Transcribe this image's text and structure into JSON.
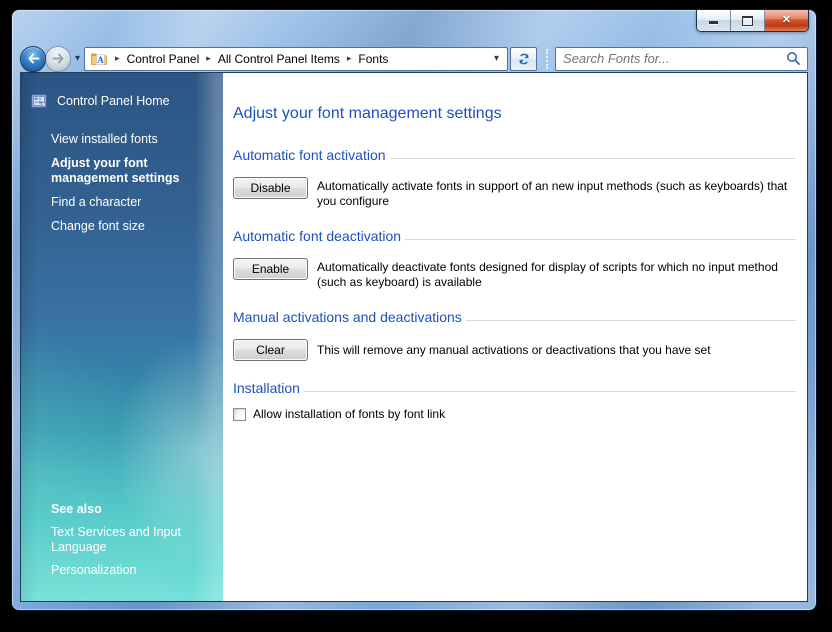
{
  "glyphs": {
    "close": "✕",
    "breadcrumb_separator": "▸",
    "dropdown_arrow": "▾",
    "recent_pages_chevron": "▾"
  },
  "navigation": {
    "breadcrumb": [
      "Control Panel",
      "All Control Panel Items",
      "Fonts"
    ],
    "search_placeholder": "Search Fonts for..."
  },
  "sidebar": {
    "home": "Control Panel Home",
    "links": [
      "View installed fonts",
      "Adjust your font management settings",
      "Find a character",
      "Change font size"
    ],
    "active_link": "Adjust your font management settings",
    "see_also": {
      "title": "See also",
      "links": [
        "Text Services and Input Language",
        "Personalization"
      ]
    }
  },
  "main": {
    "title": "Adjust your font management settings",
    "sections": [
      {
        "heading": "Automatic font activation",
        "button_label": "Disable",
        "description": "Automatically activate fonts in support of an new input methods (such as keyboards) that you configure"
      },
      {
        "heading": "Automatic font deactivation",
        "button_label": "Enable",
        "description": "Automatically deactivate fonts designed for display of scripts for which no input method (such as keyboard) is available"
      },
      {
        "heading": "Manual activations and deactivations",
        "button_label": "Clear",
        "description": "This will remove any manual activations or deactivations that you have set"
      },
      {
        "heading": "Installation",
        "checkbox_label": "Allow installation of fonts by font link",
        "checkbox_checked": false
      }
    ]
  },
  "colors": {
    "heading_blue": "#1e50be",
    "frame_blue": "#7aa6d6",
    "sidebar_top": "#2c5584",
    "sidebar_bottom": "#64dad1",
    "close_button_red": "#bf3a16"
  }
}
